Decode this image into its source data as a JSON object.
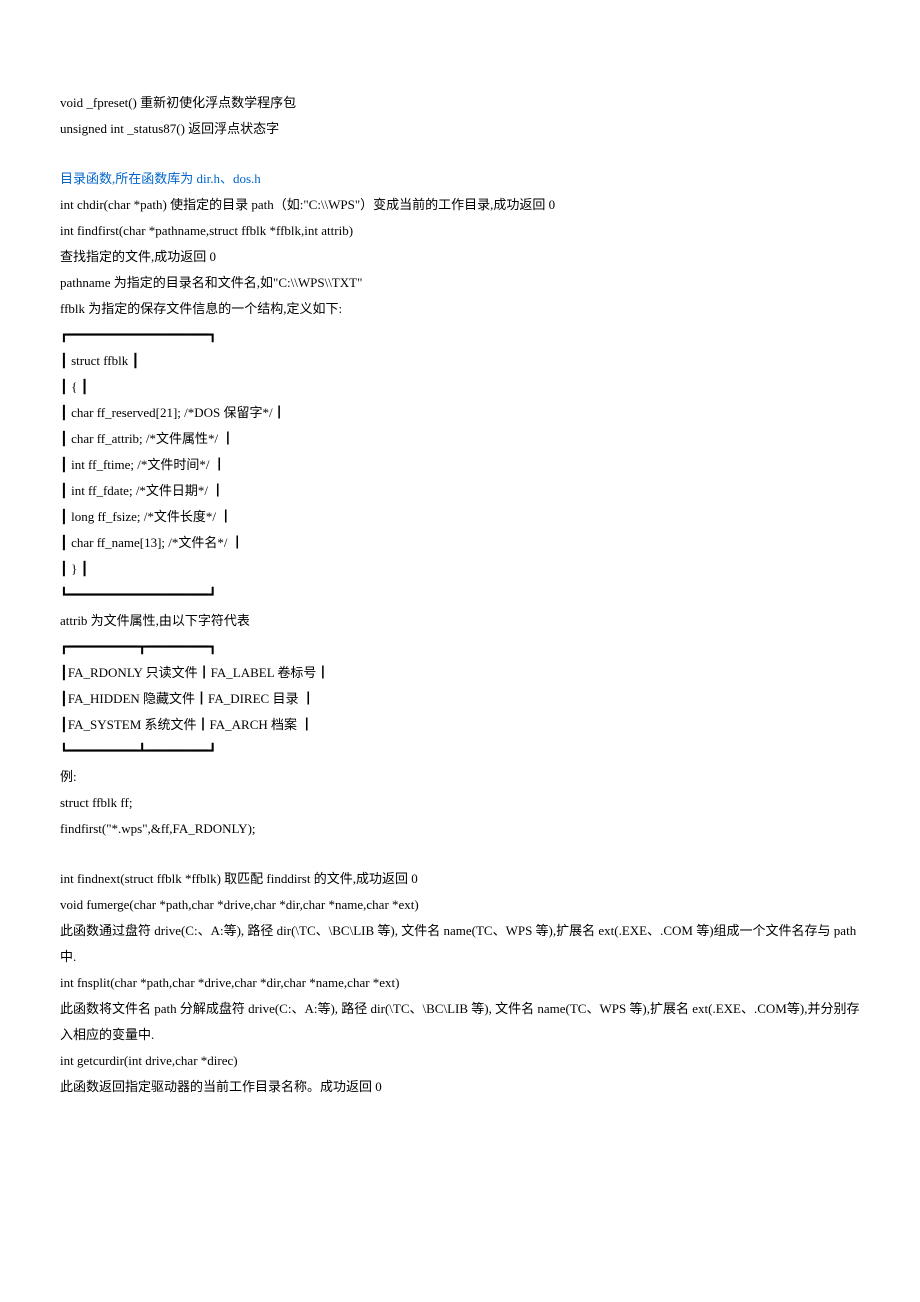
{
  "lines": [
    {
      "text": "void _fpreset()  重新初使化浮点数学程序包",
      "cls": ""
    },
    {
      "text": "unsigned int _status87()  返回浮点状态字",
      "cls": ""
    },
    {
      "text": "",
      "cls": "spacer"
    },
    {
      "text": "目录函数,所在函数库为 dir.h、dos.h",
      "cls": "section-title"
    },
    {
      "text": "int chdir(char *path)  使指定的目录 path（如:\"C:\\\\WPS\"）变成当前的工作目录,成功返回 0",
      "cls": ""
    },
    {
      "text": "int findfirst(char *pathname,struct ffblk *ffblk,int attrib)",
      "cls": ""
    },
    {
      "text": "查找指定的文件,成功返回 0",
      "cls": ""
    },
    {
      "text": "pathname 为指定的目录名和文件名,如\"C:\\\\WPS\\\\TXT\"",
      "cls": ""
    },
    {
      "text": "ffblk 为指定的保存文件信息的一个结构,定义如下:",
      "cls": ""
    },
    {
      "text": "┏━━━━━━━━━━━━━━━━━━┓",
      "cls": ""
    },
    {
      "text": "┃ struct ffblk ┃",
      "cls": ""
    },
    {
      "text": "┃ { ┃",
      "cls": ""
    },
    {
      "text": "┃ char ff_reserved[21]; /*DOS 保留字*/┃",
      "cls": ""
    },
    {
      "text": "┃ char ff_attrib; /*文件属性*/ ┃",
      "cls": ""
    },
    {
      "text": "┃ int ff_ftime; /*文件时间*/ ┃",
      "cls": ""
    },
    {
      "text": "┃ int ff_fdate; /*文件日期*/ ┃",
      "cls": ""
    },
    {
      "text": "┃ long ff_fsize; /*文件长度*/ ┃",
      "cls": ""
    },
    {
      "text": "┃ char ff_name[13]; /*文件名*/ ┃",
      "cls": ""
    },
    {
      "text": "┃ } ┃",
      "cls": ""
    },
    {
      "text": "┗━━━━━━━━━━━━━━━━━━┛",
      "cls": ""
    },
    {
      "text": "attrib 为文件属性,由以下字符代表",
      "cls": ""
    },
    {
      "text": "┏━━━━━━━━━┳━━━━━━━━┓",
      "cls": ""
    },
    {
      "text": "┃FA_RDONLY  只读文件┃FA_LABEL  卷标号┃",
      "cls": ""
    },
    {
      "text": "┃FA_HIDDEN  隐藏文件┃FA_DIREC  目录 ┃",
      "cls": ""
    },
    {
      "text": "┃FA_SYSTEM  系统文件┃FA_ARCH  档案 ┃",
      "cls": ""
    },
    {
      "text": "┗━━━━━━━━━┻━━━━━━━━┛",
      "cls": ""
    },
    {
      "text": "例:",
      "cls": ""
    },
    {
      "text": "struct ffblk ff;",
      "cls": ""
    },
    {
      "text": "findfirst(\"*.wps\",&ff,FA_RDONLY);",
      "cls": ""
    },
    {
      "text": "",
      "cls": "spacer"
    },
    {
      "text": "int findnext(struct ffblk *ffblk)  取匹配 finddirst 的文件,成功返回 0",
      "cls": ""
    },
    {
      "text": "void fumerge(char *path,char *drive,char *dir,char *name,char *ext)",
      "cls": ""
    },
    {
      "text": "此函数通过盘符 drive(C:、A:等),  路径 dir(\\TC、\\BC\\LIB 等),  文件名 name(TC、WPS 等),扩展名 ext(.EXE、.COM 等)组成一个文件名存与 path 中.",
      "cls": ""
    },
    {
      "text": "int fnsplit(char *path,char *drive,char *dir,char *name,char *ext)",
      "cls": ""
    },
    {
      "text": "此函数将文件名 path 分解成盘符 drive(C:、A:等),  路径 dir(\\TC、\\BC\\LIB 等),  文件名 name(TC、WPS 等),扩展名 ext(.EXE、.COM等),并分别存入相应的变量中.",
      "cls": ""
    },
    {
      "text": "int getcurdir(int drive,char *direc)",
      "cls": ""
    },
    {
      "text": "此函数返回指定驱动器的当前工作目录名称。成功返回 0",
      "cls": ""
    }
  ]
}
